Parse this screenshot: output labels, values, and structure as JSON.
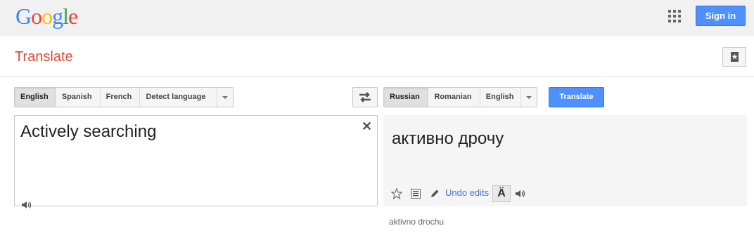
{
  "header": {
    "logo_letters": [
      {
        "char": "G",
        "color": "#4285f4"
      },
      {
        "char": "o",
        "color": "#ea4335"
      },
      {
        "char": "o",
        "color": "#fbbc05"
      },
      {
        "char": "g",
        "color": "#4285f4"
      },
      {
        "char": "l",
        "color": "#34a853"
      },
      {
        "char": "e",
        "color": "#ea4335"
      }
    ],
    "apps_icon": "apps-grid-icon",
    "sign_in_label": "Sign in"
  },
  "titlebar": {
    "title": "Translate",
    "phrasebook_icon": "phrasebook-star-icon"
  },
  "source": {
    "languages": [
      "English",
      "Spanish",
      "French",
      "Detect language"
    ],
    "selected": "English",
    "text": "Actively searching",
    "clear_icon": "close-icon",
    "listen_icon": "speaker-icon"
  },
  "swap_icon": "swap-languages-icon",
  "target": {
    "languages": [
      "Russian",
      "Romanian",
      "English"
    ],
    "selected": "Russian",
    "translate_label": "Translate",
    "text": "активно дрочу",
    "transliteration": "aktivno drochu",
    "undo_label": "Undo edits",
    "a_umlaut": "Ä",
    "tools": [
      "star-icon",
      "list-icon",
      "pencil-icon",
      "speaker-icon"
    ]
  },
  "colors": {
    "accent_blue": "#4d90fe",
    "title_red": "#dd4b39",
    "link_blue": "#4273db"
  }
}
